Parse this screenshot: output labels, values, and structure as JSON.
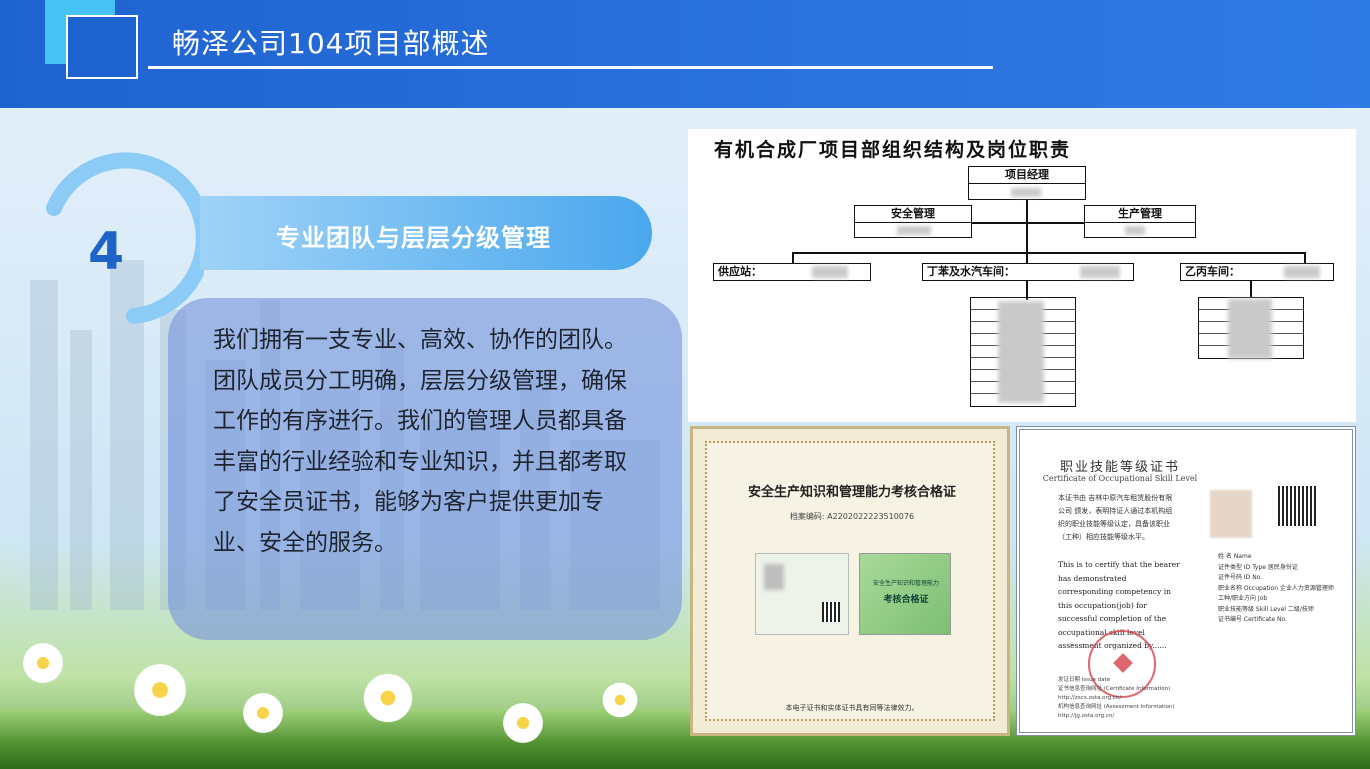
{
  "header": {
    "title": "畅泽公司104项目部概述"
  },
  "section": {
    "number": "4",
    "heading": "专业团队与层层分级管理",
    "body": "我们拥有一支专业、高效、协作的团队。团队成员分工明确，层层分级管理，确保工作的有序进行。我们的管理人员都具备丰富的行业经验和专业知识，并且都考取了安全员证书，能够为客户提供更加专业、安全的服务。"
  },
  "org_chart": {
    "title": "有机合成厂项目部组织结构及岗位职责",
    "manager": "项目经理",
    "safety": "安全管理",
    "production": "生产管理",
    "supply": "供应站：",
    "workshop1": "丁苯及水汽车间：",
    "workshop2": "乙丙车间："
  },
  "cert_safety": {
    "title": "安全生产知识和管理能力考核合格证",
    "number": "档案编码: A2202022223510076",
    "card_line1": "安全生产知识和管理能力",
    "card_line2": "考核合格证",
    "footer": "本电子证书和实体证书具有同等法律效力。"
  },
  "cert_skill": {
    "title": "职业技能等级证书",
    "subtitle": "Certificate of Occupational Skill Level",
    "para": "本证书由 吉林中原汽车租赁股份有限公司 颁发，表明持证人通过本机构组织的职业技能等级认定，具备该职业（工种）相应技能等级水平。",
    "english": "This is to certify that the bearer has demonstrated corresponding competency in this occupation(job) for successful completion of the occupational skill level assessment organized by......",
    "fields": [
      "姓 名 Name",
      "证件类型 ID Type  居民身份证",
      "证件号码 ID No.",
      "职业名称 Occupation  企业人力资源管理师",
      "工种/职业方向 Job",
      "职业技能等级 Skill Level  二级/技师",
      "证书编号 Certificate No."
    ],
    "footer_lines": [
      "发证日期 Issue date",
      "证书信息查询网址 (Certificate Information) http://zscx.osta.org.cn/",
      "机构信息查询网址 (Assessment Information) http://jg.osta.org.cn/"
    ]
  }
}
